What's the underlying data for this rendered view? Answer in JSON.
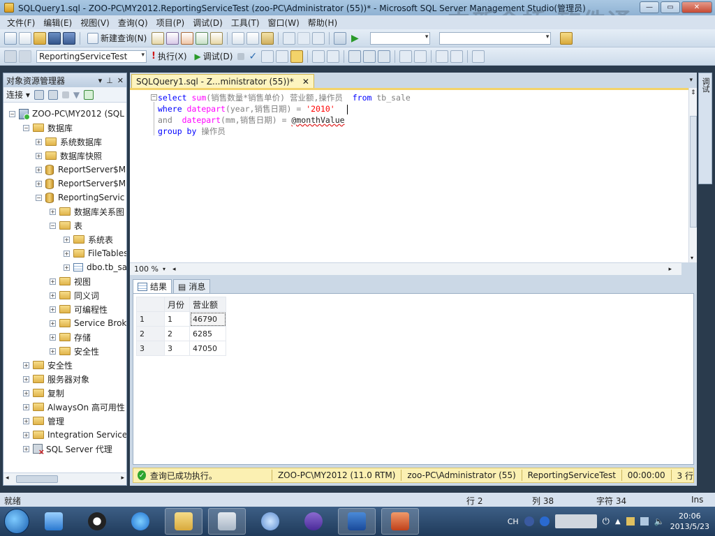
{
  "window": {
    "title": "SQLQuery1.sql - ZOO-PC\\MY2012.ReportingServiceTest (zoo-PC\\Administrator (55))* - Microsoft SQL Server Management Studio(管理员)",
    "watermark": "中新金桥 软件通",
    "min": "—",
    "max": "▭",
    "close": "✕"
  },
  "menu": [
    "文件(F)",
    "编辑(E)",
    "视图(V)",
    "查询(Q)",
    "项目(P)",
    "调试(D)",
    "工具(T)",
    "窗口(W)",
    "帮助(H)"
  ],
  "toolbar1": {
    "new_query": "新建查询(N)"
  },
  "toolbar2": {
    "database": "ReportingServiceTest",
    "execute": "执行(X)",
    "debug": "调试(D)"
  },
  "object_explorer": {
    "title": "对象资源管理器",
    "connect": "连接",
    "items": [
      "ZOO-PC\\MY2012 (SQL",
      "数据库",
      "系统数据库",
      "数据库快照",
      "ReportServer$M",
      "ReportServer$M",
      "ReportingServic",
      "数据库关系图",
      "表",
      "系统表",
      "FileTables",
      "dbo.tb_sa",
      "视图",
      "同义词",
      "可编程性",
      "Service Brok",
      "存储",
      "安全性",
      "安全性",
      "服务器对象",
      "复制",
      "AlwaysOn 高可用性",
      "管理",
      "Integration Services",
      "SQL Server 代理"
    ]
  },
  "editor": {
    "tab_label": "SQLQuery1.sql - Z...ministrator (55))*",
    "tab_close": "✕",
    "line1": {
      "select": "select",
      "sum": "sum",
      "rest": "(销售数量*销售单价) 营业额,操作员  ",
      "from": "from",
      "table": " tb_sale"
    },
    "line2": {
      "where": "where",
      "datepart": " datepart",
      "rest": "(year,销售日期) = ",
      "str": "'2010'"
    },
    "line3": {
      "and": "and",
      "datepart": "  datepart",
      "rest": "(mm,销售日期) = ",
      "var": "@monthValue"
    },
    "line4": {
      "group": "group by",
      "rest": " 操作员"
    },
    "zoom": "100 %"
  },
  "results": {
    "tab_results": "结果",
    "tab_messages": "消息",
    "columns": [
      "月份",
      "营业额"
    ],
    "rows": [
      {
        "n": "1",
        "month": "1",
        "revenue": "46790"
      },
      {
        "n": "2",
        "month": "2",
        "revenue": "6285"
      },
      {
        "n": "3",
        "month": "3",
        "revenue": "47050"
      }
    ]
  },
  "query_status": {
    "message": "查询已成功执行。",
    "server": "ZOO-PC\\MY2012 (11.0 RTM)",
    "user": "zoo-PC\\Administrator (55)",
    "db": "ReportingServiceTest",
    "time": "00:00:00",
    "rows": "3 行"
  },
  "app_status": {
    "ready": "就绪",
    "row": "行 2",
    "col": "列 38",
    "char": "字符 34",
    "ins": "Ins"
  },
  "right_strip": "调试",
  "taskbar": {
    "lang": "CH",
    "time": "20:06",
    "date": "2013/5/23"
  }
}
